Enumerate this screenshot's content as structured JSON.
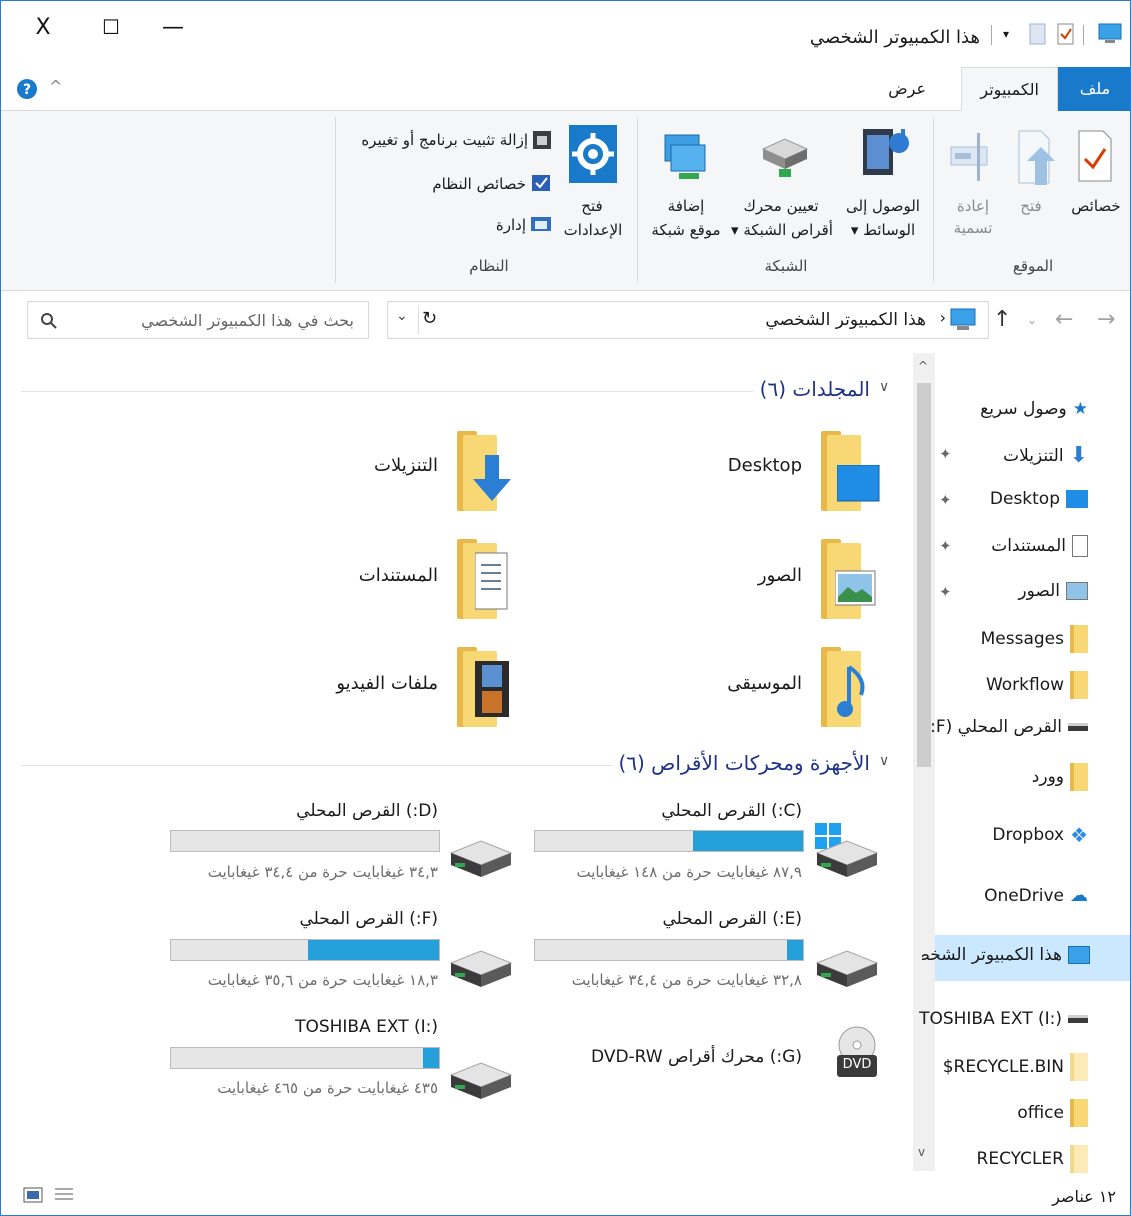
{
  "window": {
    "title": "هذا الكمبيوتر الشخصي",
    "close_glyph": "X",
    "maximize_glyph": "☐",
    "minimize_glyph": "—"
  },
  "ribbon": {
    "tabs": {
      "file": "ملف",
      "computer": "الكمبيوتر",
      "view": "عرض"
    },
    "groups": {
      "location": {
        "label": "الموقع",
        "properties": "خصائص",
        "open": "فتح",
        "rename_1": "إعادة",
        "rename_2": "تسمية"
      },
      "network": {
        "label": "الشبكة",
        "media_1": "الوصول إلى",
        "media_2": "الوسائط ▾",
        "map_1": "تعيين محرك",
        "map_2": "أقراص الشبكة ▾",
        "add_1": "إضافة",
        "add_2": "موقع شبكة"
      },
      "system": {
        "label": "النظام",
        "settings_1": "فتح",
        "settings_2": "الإعدادات",
        "uninstall": "إزالة تثبيت برنامج أو تغييره",
        "sysprops": "خصائص النظام",
        "manage": "إدارة"
      }
    }
  },
  "address": {
    "path": "هذا الكمبيوتر الشخصي",
    "search_placeholder": "بحث في هذا الكمبيوتر الشخصي"
  },
  "folders_section": {
    "heading": "المجلدات (٦)",
    "items": [
      "Desktop",
      "التنزيلات",
      "الصور",
      "المستندات",
      "الموسيقى",
      "ملفات الفيديو"
    ]
  },
  "drives_section": {
    "heading": "الأجهزة ومحركات الأقراص (٦)",
    "drives": [
      {
        "label": "(C:) القرص المحلي",
        "free": "٨٧,٩ غيغابايت حرة من ١٤٨ غيغابايت",
        "used_fraction": 0.41
      },
      {
        "label": "(D:) القرص المحلي",
        "free": "٣٤,٣ غيغابايت حرة من ٣٤,٤ غيغابايت",
        "used_fraction": 0.0
      },
      {
        "label": "(E:) القرص المحلي",
        "free": "٣٢,٨ غيغابايت حرة من ٣٤,٤ غيغابايت",
        "used_fraction": 0.06
      },
      {
        "label": "(F:) القرص المحلي",
        "free": "١٨,٣ غيغابايت حرة من ٣٥,٦ غيغابايت",
        "used_fraction": 0.49
      },
      {
        "label": "(G:) محرك أقراص DVD-RW",
        "badge": "DVD"
      },
      {
        "label": "TOSHIBA EXT (I:)",
        "free": "٤٣٥ غيغابايت حرة من ٤٦٥ غيغابايت",
        "used_fraction": 0.06
      }
    ]
  },
  "nav": {
    "quick_access": "وصول سريع",
    "downloads": "التنزيلات",
    "desktop": "Desktop",
    "documents": "المستندات",
    "pictures": "الصور",
    "messages": "Messages",
    "workflow": "Workflow",
    "local_f": "القرص المحلي (F:",
    "word": "وورد",
    "dropbox": "Dropbox",
    "onedrive": "OneDrive",
    "this_pc": "هذا الكمبيوتر الشخصي",
    "toshiba": "TOSHIBA EXT (I:)",
    "recycle_bin": "RECYCLE.BIN$",
    "office": "office",
    "recycler": "RECYCLER"
  },
  "status": {
    "items": "١٢ عناصر"
  },
  "colors": {
    "accent": "#1979ca",
    "bar_fill": "#26a0da",
    "heading": "#1e3287",
    "selection": "#cce8ff"
  }
}
